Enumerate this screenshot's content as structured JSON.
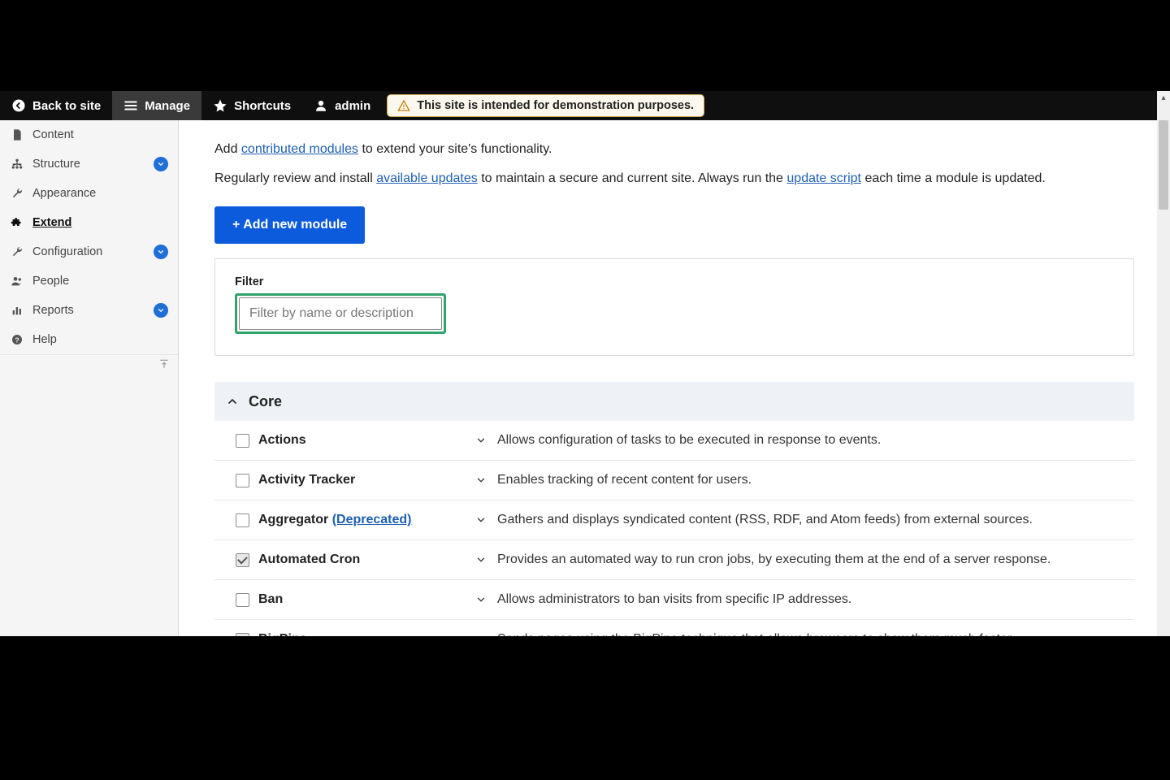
{
  "toolbar": {
    "back": "Back to site",
    "manage": "Manage",
    "shortcuts": "Shortcuts",
    "user": "admin",
    "notice": "This site is intended for demonstration purposes."
  },
  "sidebar": {
    "items": [
      {
        "label": "Content",
        "expandable": false
      },
      {
        "label": "Structure",
        "expandable": true
      },
      {
        "label": "Appearance",
        "expandable": false
      },
      {
        "label": "Extend",
        "expandable": false,
        "active": true
      },
      {
        "label": "Configuration",
        "expandable": true
      },
      {
        "label": "People",
        "expandable": false
      },
      {
        "label": "Reports",
        "expandable": true
      },
      {
        "label": "Help",
        "expandable": false
      }
    ]
  },
  "intro": {
    "line1_pre": "Add ",
    "line1_link": "contributed modules",
    "line1_post": " to extend your site's functionality.",
    "line2_pre": "Regularly review and install ",
    "line2_link1": "available updates",
    "line2_mid": " to maintain a secure and current site. Always run the ",
    "line2_link2": "update script",
    "line2_post": " each time a module is updated."
  },
  "buttons": {
    "add_module": "+ Add new module"
  },
  "filter": {
    "label": "Filter",
    "placeholder": "Filter by name or description"
  },
  "section": {
    "title": "Core"
  },
  "modules": [
    {
      "name": "Actions",
      "checked": false,
      "desc": "Allows configuration of tasks to be executed in response to events."
    },
    {
      "name": "Activity Tracker",
      "checked": false,
      "desc": "Enables tracking of recent content for users."
    },
    {
      "name": "Aggregator",
      "deprecated": "(Deprecated)",
      "checked": false,
      "desc": "Gathers and displays syndicated content (RSS, RDF, and Atom feeds) from external sources."
    },
    {
      "name": "Automated Cron",
      "checked": true,
      "desc": "Provides an automated way to run cron jobs, by executing them at the end of a server response."
    },
    {
      "name": "Ban",
      "checked": false,
      "desc": "Allows administrators to ban visits from specific IP addresses."
    },
    {
      "name": "BigPipe",
      "checked": true,
      "desc": "Sends pages using the BigPipe technique that allows browsers to show them much faster."
    }
  ]
}
